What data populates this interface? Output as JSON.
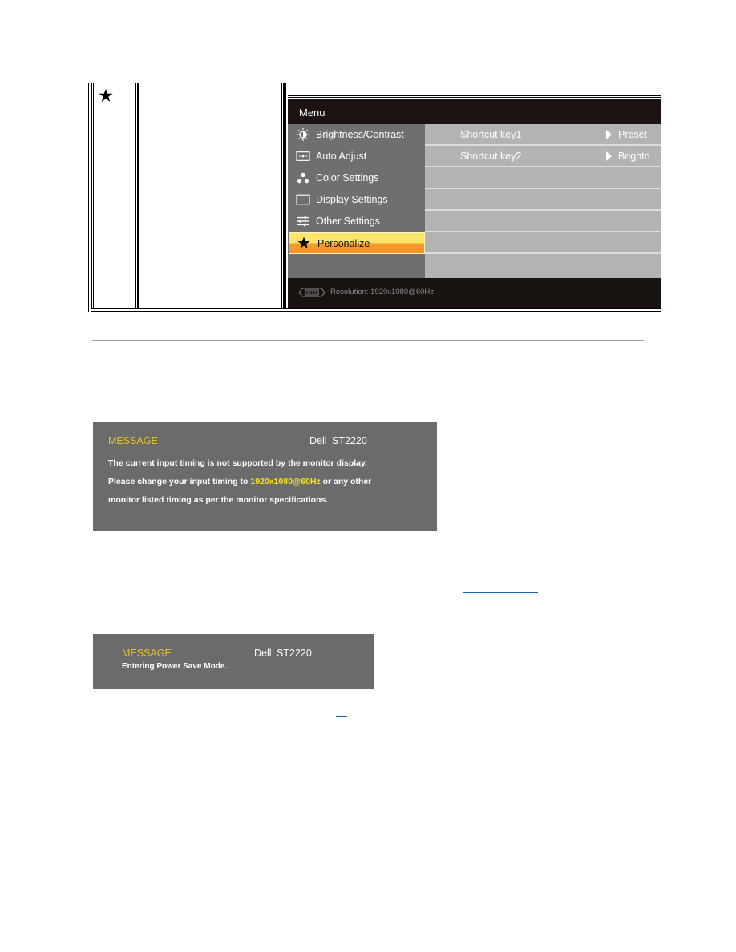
{
  "table_row": {
    "icon": "star-icon",
    "description": "",
    "osd_menu": {
      "title": "Menu",
      "items": [
        {
          "label": "Brightness/Contrast",
          "icon": "brightness-icon",
          "active": false
        },
        {
          "label": "Auto Adjust",
          "icon": "auto-adjust-icon",
          "active": false
        },
        {
          "label": "Color Settings",
          "icon": "color-settings-icon",
          "active": false
        },
        {
          "label": "Display Settings",
          "icon": "display-settings-icon",
          "active": false
        },
        {
          "label": "Other Settings",
          "icon": "other-settings-icon",
          "active": false
        },
        {
          "label": "Personalize",
          "icon": "star-icon",
          "active": true
        }
      ],
      "options": [
        {
          "label": "Shortcut key1",
          "value": "Preset"
        },
        {
          "label": "Shortcut key2",
          "value": "Brightn"
        }
      ],
      "footer": {
        "connector_icon": "vga-connector-icon",
        "resolution": "Resolution:  1920x1080@60Hz"
      },
      "colors": {
        "header_bg": "#1b1413",
        "left_panel_bg": "#6f6f6f",
        "right_panel_bg": "#b3b3b3",
        "active_top": "#fbe46a",
        "active_bottom": "#f49327"
      }
    }
  },
  "messages": [
    {
      "title": "MESSAGE",
      "brand": "Dell",
      "model": "ST2220",
      "lines": [
        {
          "text": "The current input timing is not supported by the monitor display."
        },
        {
          "pre": "Please change your input timing to ",
          "highlight": "1920x1080@60Hz",
          "post": " or any other"
        },
        {
          "text": "monitor listed timing as per the monitor specifications."
        }
      ]
    },
    {
      "title": "MESSAGE",
      "brand": "Dell",
      "model": "ST2220",
      "lines": [
        {
          "text": "Entering Power Save Mode."
        }
      ]
    }
  ],
  "links": [
    {
      "label": ""
    },
    {
      "label": ""
    }
  ],
  "colors": {
    "message_bg": "#6b6b6b",
    "message_title": "#e8c21c",
    "message_highlight": "#f4e21a",
    "link": "#1a66b0"
  }
}
